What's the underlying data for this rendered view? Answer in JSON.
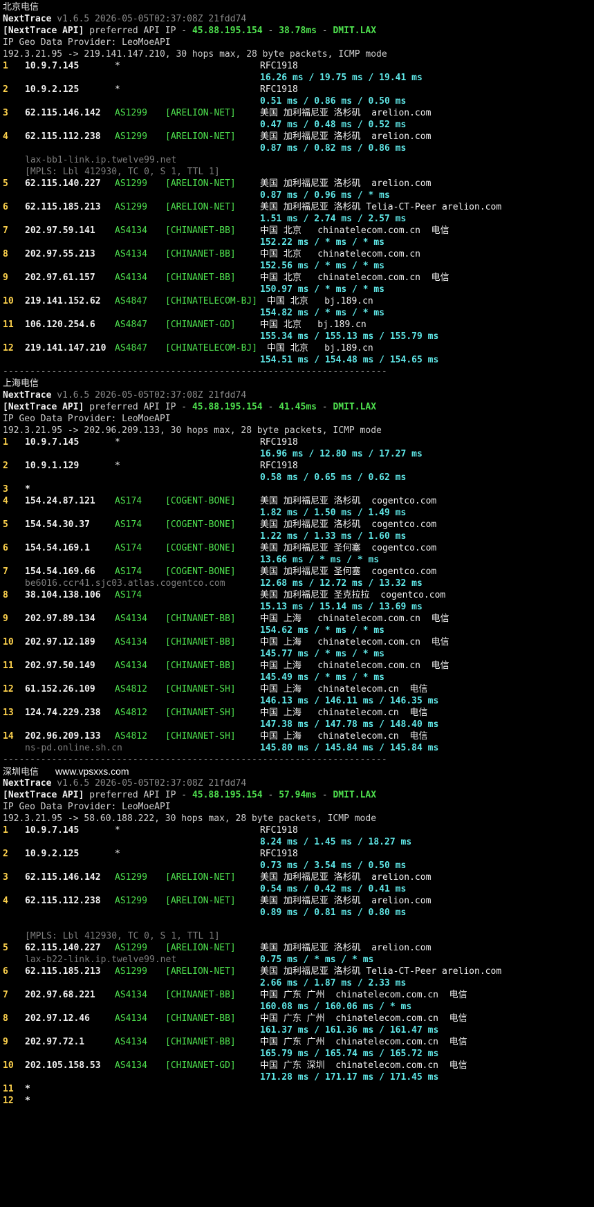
{
  "colors": {
    "background": "#000000",
    "hop_index": "#ffd34d",
    "asn": "#4ee04e",
    "latency": "#5fe6e6",
    "dim": "#8a8a8a"
  },
  "sections": [
    {
      "title": "北京电信",
      "watermark": "",
      "header": {
        "app": "NextTrace",
        "version": "v1.6.5 2026-05-05T02:37:08Z 21fdd74",
        "api_prefix": "[NextTrace API]",
        "api_text": "preferred API IP -",
        "api_ip": "45.88.195.154",
        "api_latency": "38.78ms",
        "api_node": "DMIT.LAX",
        "provider": "IP Geo Data Provider: LeoMoeAPI",
        "route": "192.3.21.95 -> 219.141.147.210, 30 hops max, 28 byte packets, ICMP mode"
      },
      "hops": [
        {
          "hop": "1",
          "ip": "10.9.7.145",
          "asn": "*",
          "tag": "",
          "geo": "RFC1918",
          "lat": "16.26 ms / 19.75 ms / 19.41 ms",
          "extra": []
        },
        {
          "hop": "2",
          "ip": "10.9.2.125",
          "asn": "*",
          "tag": "",
          "geo": "RFC1918",
          "lat": "0.51 ms / 0.86 ms / 0.50 ms",
          "extra": []
        },
        {
          "hop": "3",
          "ip": "62.115.146.142",
          "asn": "AS1299",
          "tag": "[ARELION-NET]",
          "geo": "美国 加利福尼亚 洛杉矶  arelion.com",
          "lat": "0.47 ms / 0.48 ms / 0.52 ms",
          "extra": []
        },
        {
          "hop": "4",
          "ip": "62.115.112.238",
          "asn": "AS1299",
          "tag": "[ARELION-NET]",
          "geo": "美国 加利福尼亚 洛杉矶  arelion.com",
          "lat": "0.87 ms / 0.82 ms / 0.86 ms",
          "extra": [
            "lax-bb1-link.ip.twelve99.net",
            "[MPLS: Lbl 412930, TC 0, S 1, TTL 1]"
          ]
        },
        {
          "hop": "5",
          "ip": "62.115.140.227",
          "asn": "AS1299",
          "tag": "[ARELION-NET]",
          "geo": "美国 加利福尼亚 洛杉矶  arelion.com",
          "lat": "0.87 ms / 0.96 ms / * ms",
          "extra": []
        },
        {
          "hop": "6",
          "ip": "62.115.185.213",
          "asn": "AS1299",
          "tag": "[ARELION-NET]",
          "geo": "美国 加利福尼亚 洛杉矶 Telia-CT-Peer arelion.com",
          "lat": "1.51 ms / 2.74 ms / 2.57 ms",
          "extra": []
        },
        {
          "hop": "7",
          "ip": "202.97.59.141",
          "asn": "AS4134",
          "tag": "[CHINANET-BB]",
          "geo": "中国 北京   chinatelecom.com.cn  电信",
          "lat": "152.22 ms / * ms / * ms",
          "extra": []
        },
        {
          "hop": "8",
          "ip": "202.97.55.213",
          "asn": "AS4134",
          "tag": "[CHINANET-BB]",
          "geo": "中国 北京   chinatelecom.com.cn",
          "lat": "152.56 ms / * ms / * ms",
          "extra": []
        },
        {
          "hop": "9",
          "ip": "202.97.61.157",
          "asn": "AS4134",
          "tag": "[CHINANET-BB]",
          "geo": "中国 北京   chinatelecom.com.cn  电信",
          "lat": "150.97 ms / * ms / * ms",
          "extra": []
        },
        {
          "hop": "10",
          "ip": "219.141.152.62",
          "asn": "AS4847",
          "tag": "[CHINATELECOM-BJ]",
          "geo": "中国 北京   bj.189.cn",
          "lat": "154.82 ms / * ms / * ms",
          "extra": [],
          "geo_shift": true
        },
        {
          "hop": "11",
          "ip": "106.120.254.6",
          "asn": "AS4847",
          "tag": "[CHINANET-GD]",
          "geo": "中国 北京   bj.189.cn",
          "lat": "155.34 ms / 155.13 ms / 155.79 ms",
          "extra": []
        },
        {
          "hop": "12",
          "ip": "219.141.147.210",
          "asn": "AS4847",
          "tag": "[CHINATELECOM-BJ]",
          "geo": "中国 北京   bj.189.cn",
          "lat": "154.51 ms / 154.48 ms / 154.65 ms",
          "extra": [],
          "geo_shift": true
        }
      ]
    },
    {
      "title": "上海电信",
      "watermark": "",
      "header": {
        "app": "NextTrace",
        "version": "v1.6.5 2026-05-05T02:37:08Z 21fdd74",
        "api_prefix": "[NextTrace API]",
        "api_text": "preferred API IP -",
        "api_ip": "45.88.195.154",
        "api_latency": "41.45ms",
        "api_node": "DMIT.LAX",
        "provider": "IP Geo Data Provider: LeoMoeAPI",
        "route": "192.3.21.95 -> 202.96.209.133, 30 hops max, 28 byte packets, ICMP mode"
      },
      "hops": [
        {
          "hop": "1",
          "ip": "10.9.7.145",
          "asn": "*",
          "tag": "",
          "geo": "RFC1918",
          "lat": "16.96 ms / 12.80 ms / 17.27 ms",
          "extra": []
        },
        {
          "hop": "2",
          "ip": "10.9.1.129",
          "asn": "*",
          "tag": "",
          "geo": "RFC1918",
          "lat": "0.58 ms / 0.65 ms / 0.62 ms",
          "extra": []
        },
        {
          "hop": "3",
          "ip": "*",
          "asn": "",
          "tag": "",
          "geo": "",
          "lat": "",
          "extra": [],
          "star": true
        },
        {
          "hop": "4",
          "ip": "154.24.87.121",
          "asn": "AS174",
          "tag": "[COGENT-BONE]",
          "geo": "美国 加利福尼亚 洛杉矶  cogentco.com",
          "lat": "1.82 ms / 1.50 ms / 1.49 ms",
          "extra": []
        },
        {
          "hop": "5",
          "ip": "154.54.30.37",
          "asn": "AS174",
          "tag": "[COGENT-BONE]",
          "geo": "美国 加利福尼亚 洛杉矶  cogentco.com",
          "lat": "1.22 ms / 1.33 ms / 1.60 ms",
          "extra": []
        },
        {
          "hop": "6",
          "ip": "154.54.169.1",
          "asn": "AS174",
          "tag": "[COGENT-BONE]",
          "geo": "美国 加利福尼亚 圣何塞  cogentco.com",
          "lat": "13.66 ms / * ms / * ms",
          "extra": []
        },
        {
          "hop": "7",
          "ip": "154.54.169.66",
          "asn": "AS174",
          "tag": "[COGENT-BONE]",
          "geo": "美国 加利福尼亚 圣何塞  cogentco.com",
          "lat": "12.68 ms / 12.72 ms / 13.32 ms",
          "extra_inline": "be6016.ccr41.sjc03.atlas.cogentco.com",
          "extra": []
        },
        {
          "hop": "8",
          "ip": "38.104.138.106",
          "asn": "AS174",
          "tag": "",
          "geo": "美国 加利福尼亚 圣克拉拉  cogentco.com",
          "lat": "15.13 ms / 15.14 ms / 13.69 ms",
          "extra": []
        },
        {
          "hop": "9",
          "ip": "202.97.89.134",
          "asn": "AS4134",
          "tag": "[CHINANET-BB]",
          "geo": "中国 上海   chinatelecom.com.cn  电信",
          "lat": "154.62 ms / * ms / * ms",
          "extra": []
        },
        {
          "hop": "10",
          "ip": "202.97.12.189",
          "asn": "AS4134",
          "tag": "[CHINANET-BB]",
          "geo": "中国 上海   chinatelecom.com.cn  电信",
          "lat": "145.77 ms / * ms / * ms",
          "extra": []
        },
        {
          "hop": "11",
          "ip": "202.97.50.149",
          "asn": "AS4134",
          "tag": "[CHINANET-BB]",
          "geo": "中国 上海   chinatelecom.com.cn  电信",
          "lat": "145.49 ms / * ms / * ms",
          "extra": []
        },
        {
          "hop": "12",
          "ip": "61.152.26.109",
          "asn": "AS4812",
          "tag": "[CHINANET-SH]",
          "geo": "中国 上海   chinatelecom.cn  电信",
          "lat": "146.13 ms / 146.11 ms / 146.35 ms",
          "extra": []
        },
        {
          "hop": "13",
          "ip": "124.74.229.238",
          "asn": "AS4812",
          "tag": "[CHINANET-SH]",
          "geo": "中国 上海   chinatelecom.cn  电信",
          "lat": "147.38 ms / 147.78 ms / 148.40 ms",
          "extra": []
        },
        {
          "hop": "14",
          "ip": "202.96.209.133",
          "asn": "AS4812",
          "tag": "[CHINANET-SH]",
          "geo": "中国 上海   chinatelecom.cn  电信",
          "lat": "145.80 ms / 145.84 ms / 145.84 ms",
          "extra_inline": "ns-pd.online.sh.cn",
          "extra": []
        }
      ]
    },
    {
      "title": "深圳电信",
      "watermark": "www.vpsxxs.com",
      "header": {
        "app": "NextTrace",
        "version": "v1.6.5 2026-05-05T02:37:08Z 21fdd74",
        "api_prefix": "[NextTrace API]",
        "api_text": "preferred API IP -",
        "api_ip": "45.88.195.154",
        "api_latency": "57.94ms",
        "api_node": "DMIT.LAX",
        "provider": "IP Geo Data Provider: LeoMoeAPI",
        "route": "192.3.21.95 -> 58.60.188.222, 30 hops max, 28 byte packets, ICMP mode"
      },
      "hops": [
        {
          "hop": "1",
          "ip": "10.9.7.145",
          "asn": "*",
          "tag": "",
          "geo": "RFC1918",
          "lat": "8.24 ms / 1.45 ms / 18.27 ms",
          "extra": []
        },
        {
          "hop": "2",
          "ip": "10.9.2.125",
          "asn": "*",
          "tag": "",
          "geo": "RFC1918",
          "lat": "0.73 ms / 3.54 ms / 0.50 ms",
          "extra": []
        },
        {
          "hop": "3",
          "ip": "62.115.146.142",
          "asn": "AS1299",
          "tag": "[ARELION-NET]",
          "geo": "美国 加利福尼亚 洛杉矶  arelion.com",
          "lat": "0.54 ms / 0.42 ms / 0.41 ms",
          "extra": []
        },
        {
          "hop": "4",
          "ip": "62.115.112.238",
          "asn": "AS1299",
          "tag": "[ARELION-NET]",
          "geo": "美国 加利福尼亚 洛杉矶  arelion.com",
          "lat": "0.89 ms / 0.81 ms / 0.80 ms",
          "extra": [
            "",
            "[MPLS: Lbl 412930, TC 0, S 1, TTL 1]"
          ]
        },
        {
          "hop": "5",
          "ip": "62.115.140.227",
          "asn": "AS1299",
          "tag": "[ARELION-NET]",
          "geo": "美国 加利福尼亚 洛杉矶  arelion.com",
          "lat": "0.75 ms / * ms / * ms",
          "extra_inline": "lax-b22-link.ip.twelve99.net",
          "extra": []
        },
        {
          "hop": "6",
          "ip": "62.115.185.213",
          "asn": "AS1299",
          "tag": "[ARELION-NET]",
          "geo": "美国 加利福尼亚 洛杉矶 Telia-CT-Peer arelion.com",
          "lat": "2.66 ms / 1.87 ms / 2.33 ms",
          "extra": []
        },
        {
          "hop": "7",
          "ip": "202.97.68.221",
          "asn": "AS4134",
          "tag": "[CHINANET-BB]",
          "geo": "中国 广东 广州  chinatelecom.com.cn  电信",
          "lat": "160.08 ms / 160.06 ms / * ms",
          "extra": []
        },
        {
          "hop": "8",
          "ip": "202.97.12.46",
          "asn": "AS4134",
          "tag": "[CHINANET-BB]",
          "geo": "中国 广东 广州  chinatelecom.com.cn  电信",
          "lat": "161.37 ms / 161.36 ms / 161.47 ms",
          "extra": []
        },
        {
          "hop": "9",
          "ip": "202.97.72.1",
          "asn": "AS4134",
          "tag": "[CHINANET-BB]",
          "geo": "中国 广东 广州  chinatelecom.com.cn  电信",
          "lat": "165.79 ms / 165.74 ms / 165.72 ms",
          "extra": []
        },
        {
          "hop": "10",
          "ip": "202.105.158.53",
          "asn": "AS4134",
          "tag": "[CHINANET-GD]",
          "geo": "中国 广东 深圳  chinatelecom.com.cn  电信",
          "lat": "171.28 ms / 171.17 ms / 171.45 ms",
          "extra": []
        },
        {
          "hop": "11",
          "ip": "*",
          "asn": "",
          "tag": "",
          "geo": "",
          "lat": "",
          "extra": [],
          "star": true
        },
        {
          "hop": "12",
          "ip": "*",
          "asn": "",
          "tag": "",
          "geo": "",
          "lat": "",
          "extra": [],
          "star": true
        }
      ]
    }
  ],
  "separator": "-----------------------------------------------------------------------"
}
